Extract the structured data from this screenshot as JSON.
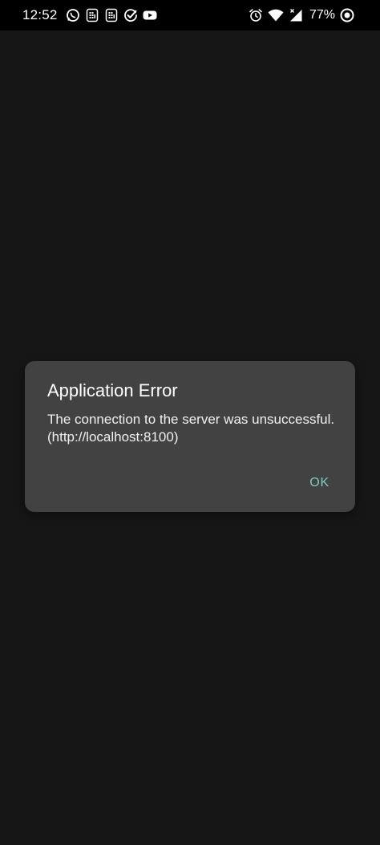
{
  "status_bar": {
    "time": "12:52",
    "battery_percent": "77%",
    "left_icons": [
      "whatsapp-icon",
      "sim-app-icon",
      "sim-app-icon-2",
      "task-check-icon",
      "youtube-icon"
    ],
    "right_icons": [
      "alarm-icon",
      "wifi-icon",
      "cell-signal-icon",
      "battery-icon"
    ]
  },
  "dialog": {
    "title": "Application Error",
    "message": "The connection to the server was unsuccessful. (http://localhost:8100)",
    "ok_label": "OK"
  },
  "colors": {
    "background": "#161616",
    "dialog_bg": "#424242",
    "accent": "#80cbc4"
  }
}
